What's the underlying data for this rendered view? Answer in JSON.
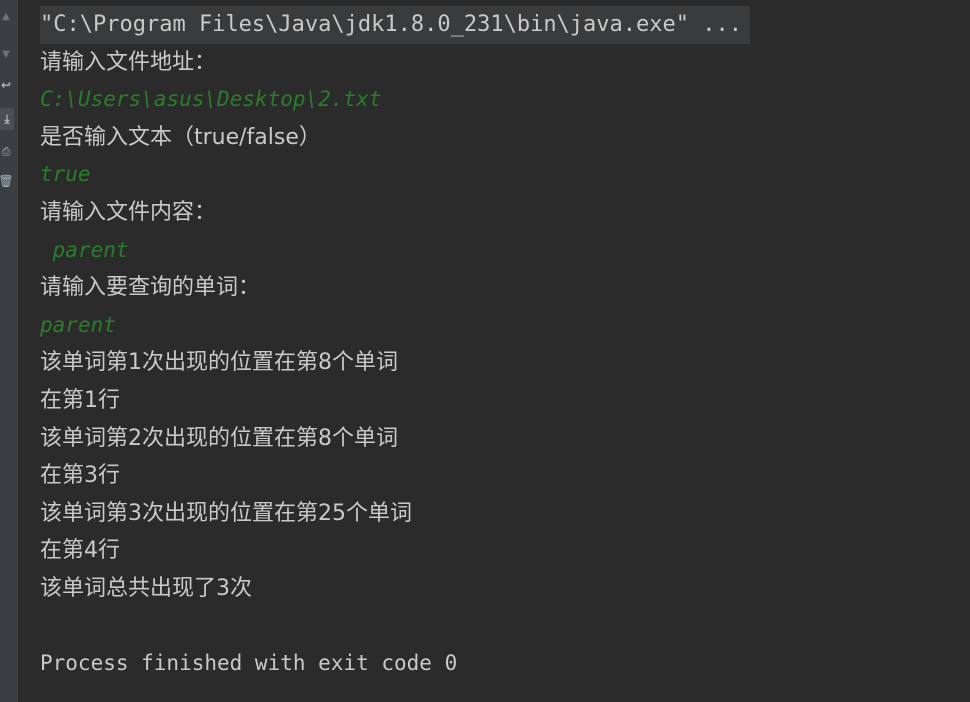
{
  "console": {
    "command_line": "\"C:\\Program Files\\Java\\jdk1.8.0_231\\bin\\java.exe\" ...",
    "lines": [
      {
        "kind": "out",
        "text": "请输入文件地址："
      },
      {
        "kind": "in",
        "text": "C:\\Users\\asus\\Desktop\\2.txt"
      },
      {
        "kind": "out",
        "text": "是否输入文本（true/false）"
      },
      {
        "kind": "in",
        "text": "true"
      },
      {
        "kind": "out",
        "text": "请输入文件内容："
      },
      {
        "kind": "in",
        "text": " parent"
      },
      {
        "kind": "out",
        "text": "请输入要查询的单词："
      },
      {
        "kind": "in",
        "text": "parent"
      },
      {
        "kind": "out",
        "text": "该单词第1次出现的位置在第8个单词"
      },
      {
        "kind": "out",
        "text": "在第1行"
      },
      {
        "kind": "out",
        "text": "该单词第2次出现的位置在第8个单词"
      },
      {
        "kind": "out",
        "text": "在第3行"
      },
      {
        "kind": "out",
        "text": "该单词第3次出现的位置在第25个单词"
      },
      {
        "kind": "out",
        "text": "在第4行"
      },
      {
        "kind": "out",
        "text": "该单词总共出现了3次"
      }
    ],
    "process_message": "Process finished with exit code 0"
  },
  "toolbar": {
    "icons": [
      "arrow-up-icon",
      "arrow-down-icon",
      "soft-wrap-icon",
      "scroll-to-end-icon",
      "print-icon",
      "clear-all-icon"
    ]
  },
  "colors": {
    "background": "#2b2b2b",
    "gutter": "#3c3f41",
    "output_text": "#c9c9c9",
    "user_input": "#2a7d2a",
    "command_highlight": "#3a3b3c"
  }
}
